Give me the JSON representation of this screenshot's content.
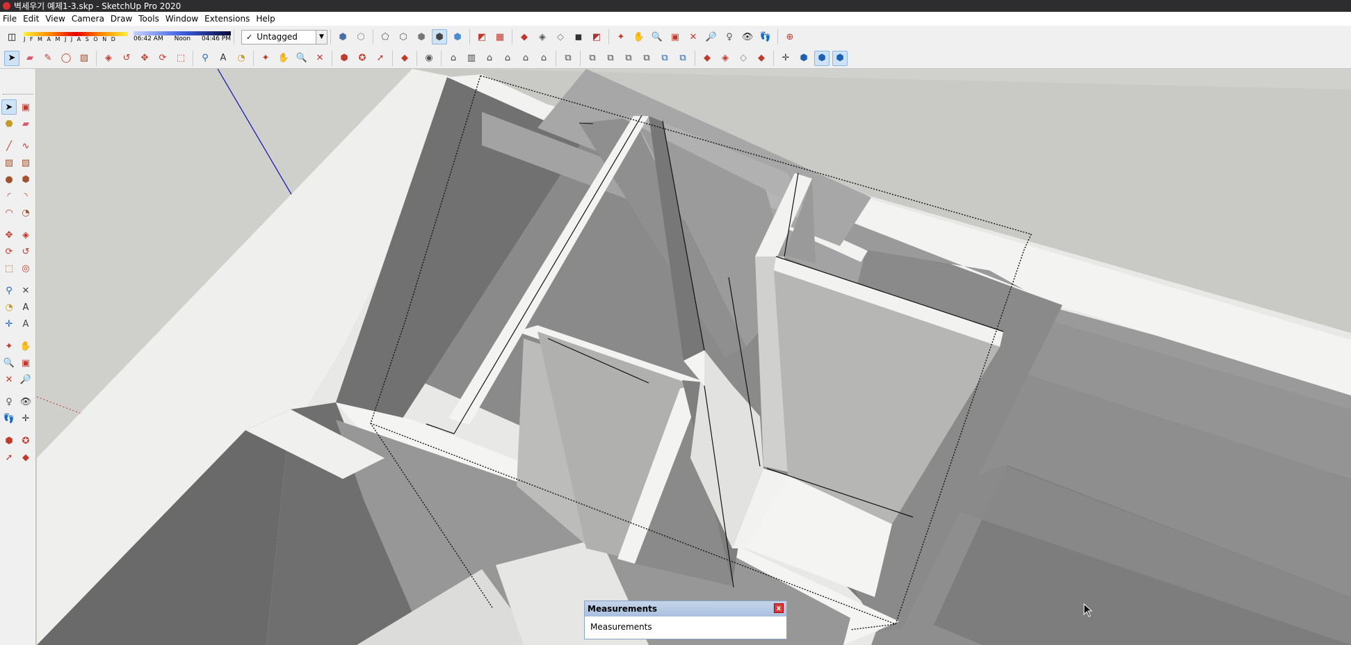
{
  "window": {
    "title": "벽세우기 예제1-3.skp - SketchUp Pro 2020"
  },
  "menu": [
    "File",
    "Edit",
    "View",
    "Camera",
    "Draw",
    "Tools",
    "Window",
    "Extensions",
    "Help"
  ],
  "shadows": {
    "months": "J F M A M J J A S O N D",
    "time_start": "06:42 AM",
    "time_mid": "Noon",
    "time_end": "04:46 PM"
  },
  "tag": {
    "checkmark": "✓",
    "selected": "Untagged"
  },
  "toolbar_top": [
    "style-icon",
    "style-icon",
    "style-icon",
    "style-icon",
    "style-icon",
    "style-icon",
    "section-icon",
    "section-icon",
    "component-icon",
    "component-icon",
    "component-icon",
    "component-icon",
    "component-icon",
    "orbit-icon",
    "pan-icon",
    "zoom-icon",
    "zoom-window-icon",
    "zoom-extents-icon",
    "zoom-previous-icon",
    "position-camera-icon",
    "look-around-icon",
    "walk-icon",
    "globe-icon"
  ],
  "toolbar_second": [
    "select-icon",
    "eraser-icon",
    "pencil-icon",
    "shapes-icon",
    "paint-icon",
    "push-pull-icon",
    "follow-me-icon",
    "move-icon",
    "rotate-icon",
    "scale-icon",
    "tape-icon",
    "text-icon",
    "protractor-icon",
    "orbit-icon",
    "pan-icon",
    "zoom-icon",
    "zoom-extents-icon",
    "warehouse-icon",
    "extension-icon",
    "send-icon",
    "ruby-icon",
    "user-icon",
    "iso-view-icon",
    "top-view-icon",
    "front-view-icon",
    "right-view-icon",
    "back-view-icon",
    "left-view-icon",
    "group-icon",
    "solid-union-icon",
    "solid-subtract-icon",
    "solid-trim-icon",
    "solid-split-icon",
    "solid-outer-icon",
    "sandbox-icon",
    "sandbox-icon",
    "sandbox-icon",
    "sandbox-icon",
    "axes-icon",
    "xray-icon",
    "backedge-icon",
    "wireframe-icon"
  ],
  "measurements": {
    "title": "Measurements",
    "label": "Measurements",
    "close": "x"
  }
}
